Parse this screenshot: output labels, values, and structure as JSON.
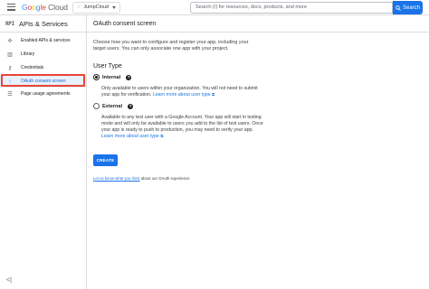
{
  "topbar": {
    "logo_google": "Google",
    "logo_cloud": "Cloud",
    "project_name": "JumpCloud",
    "search_placeholder": "Search (/) for resources, docs, products, and more",
    "search_button": "Search"
  },
  "sidebar": {
    "badge": "RPI",
    "title": "APIs & Services",
    "items": [
      {
        "label": "Enabled APIs & services",
        "icon": "enabled-apis-icon"
      },
      {
        "label": "Library",
        "icon": "library-icon"
      },
      {
        "label": "Credentials",
        "icon": "key-icon"
      },
      {
        "label": "OAuth consent screen",
        "icon": "consent-screen-icon"
      },
      {
        "label": "Page usage agreements",
        "icon": "settings-list-icon"
      }
    ],
    "collapse_label": "<|"
  },
  "main": {
    "page_title": "OAuth consent screen",
    "intro": "Choose how you want to configure and register your app, including your target users. You can only associate one app with your project.",
    "user_type_heading": "User Type",
    "internal": {
      "label": "Internal",
      "desc": "Only available to users within your organization. You will not need to submit your app for verification.",
      "link": "Learn more about user type"
    },
    "external": {
      "label": "External",
      "desc": "Available to any test user with a Google Account. Your app will start in testing mode and will only be available to users you add to the list of test users. Once your app is ready to push to production, you may need to verify your app.",
      "link": "Learn more about user type"
    },
    "create_button": "CREATE",
    "footer_link": "Let us know what you think",
    "footer_text": " about our OAuth experience"
  },
  "colors": {
    "accent": "#1a73e8",
    "highlight": "#ea4335"
  }
}
